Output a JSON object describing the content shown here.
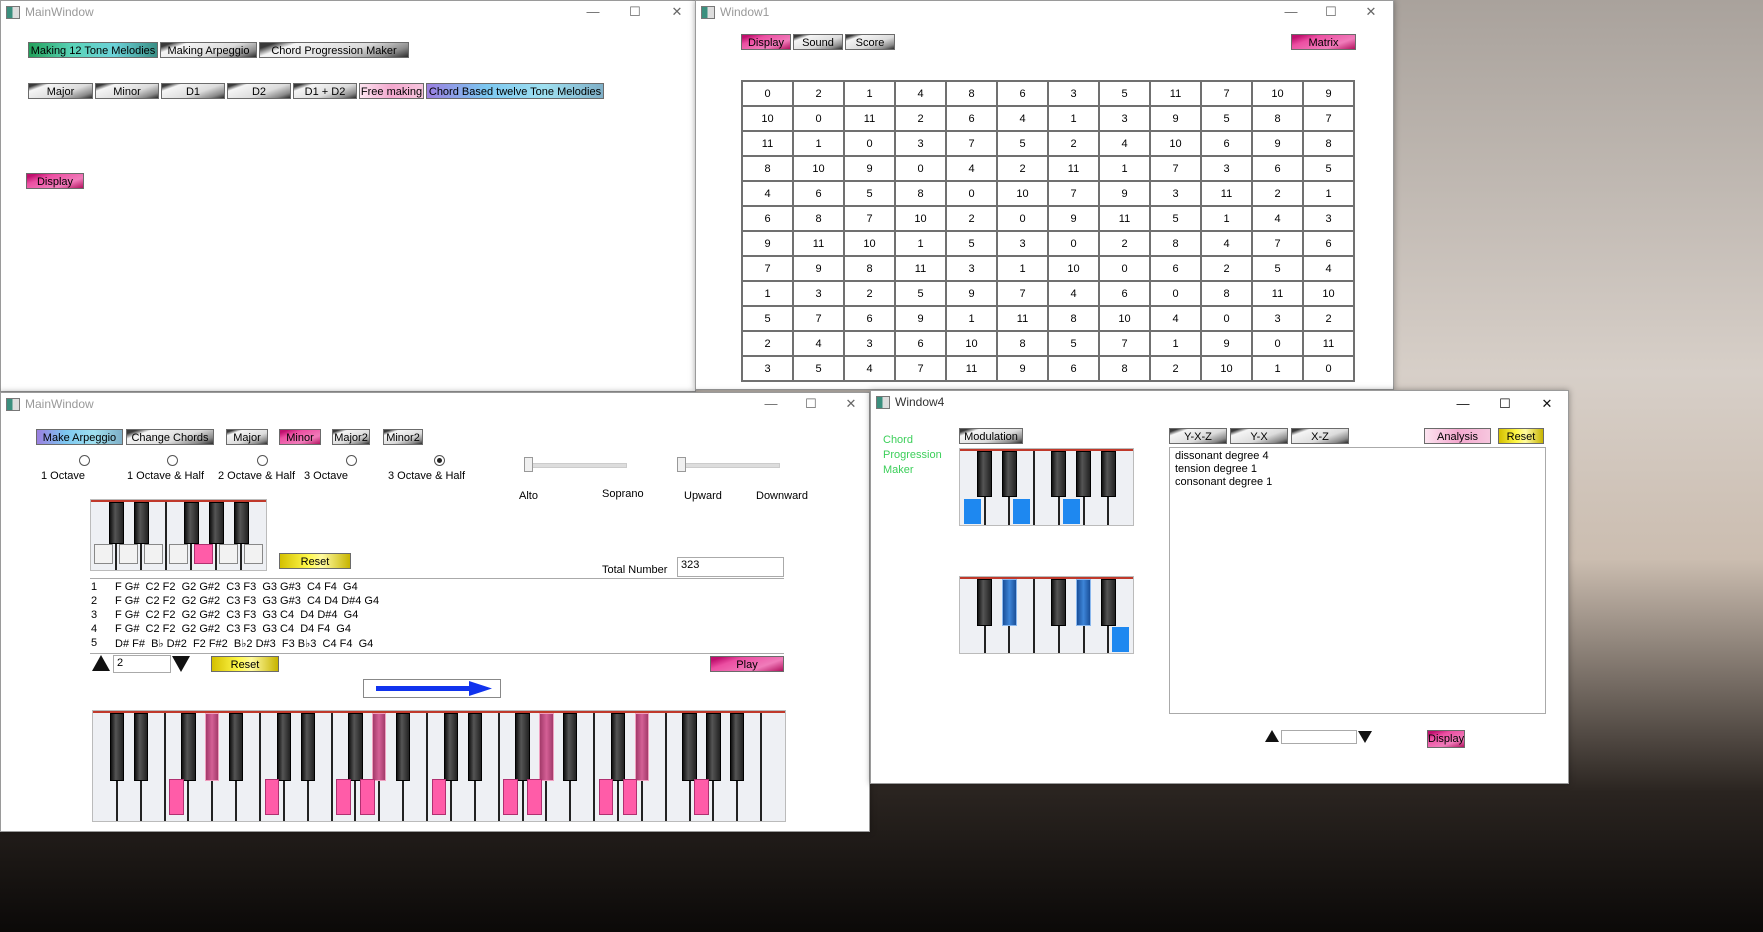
{
  "win_main1": {
    "title": "MainWindow",
    "mode_buttons": [
      "Making 12 Tone Melodies",
      "Making Arpeggio",
      "Chord Progression Maker"
    ],
    "type_buttons": [
      "Major",
      "Minor",
      "D1",
      "D2",
      "D1 + D2",
      "Free making",
      "Chord Based twelve Tone Melodies"
    ],
    "display_label": "Display"
  },
  "win1": {
    "title": "Window1",
    "tabs": [
      "Display",
      "Sound",
      "Score"
    ],
    "matrix_label": "Matrix",
    "matrix": [
      [
        0,
        2,
        1,
        4,
        8,
        6,
        3,
        5,
        11,
        7,
        10,
        9
      ],
      [
        10,
        0,
        11,
        2,
        6,
        4,
        1,
        3,
        9,
        5,
        8,
        7
      ],
      [
        11,
        1,
        0,
        3,
        7,
        5,
        2,
        4,
        10,
        6,
        9,
        8
      ],
      [
        8,
        10,
        9,
        0,
        4,
        2,
        11,
        1,
        7,
        3,
        6,
        5
      ],
      [
        4,
        6,
        5,
        8,
        0,
        10,
        7,
        9,
        3,
        11,
        2,
        1
      ],
      [
        6,
        8,
        7,
        10,
        2,
        0,
        9,
        11,
        5,
        1,
        4,
        3
      ],
      [
        9,
        11,
        10,
        1,
        5,
        3,
        0,
        2,
        8,
        4,
        7,
        6
      ],
      [
        7,
        9,
        8,
        11,
        3,
        1,
        10,
        0,
        6,
        2,
        5,
        4
      ],
      [
        1,
        3,
        2,
        5,
        9,
        7,
        4,
        6,
        0,
        8,
        11,
        10
      ],
      [
        5,
        7,
        6,
        9,
        1,
        11,
        8,
        10,
        4,
        0,
        3,
        2
      ],
      [
        2,
        4,
        3,
        6,
        10,
        8,
        5,
        7,
        1,
        9,
        0,
        11
      ],
      [
        3,
        5,
        4,
        7,
        11,
        9,
        6,
        8,
        2,
        10,
        1,
        0
      ]
    ]
  },
  "win_main2": {
    "title": "MainWindow",
    "buttons": [
      "Make Arpeggio",
      "Change Chords",
      "Major",
      "Minor",
      "Major2",
      "Minor2"
    ],
    "octave_options": [
      "1 Octave",
      "1 Octave & Half",
      "2 Octave & Half",
      "3 Octave",
      "3 Octave & Half"
    ],
    "octave_selected": 4,
    "slider1_labels": [
      "Alto",
      "Soprano"
    ],
    "slider2_labels": [
      "Upward",
      "Downward"
    ],
    "slider1_value": 0,
    "slider2_value": 0,
    "reset_label": "Reset",
    "total_number_label": "Total Number",
    "total_number_value": "323",
    "small_keyboard_selected_index": 4,
    "melodies": [
      {
        "n": "1",
        "notes": "F G#  C2 F2  G2 G#2  C3 F3  G3 G#3  C4 F4  G4"
      },
      {
        "n": "2",
        "notes": "F G#  C2 F2  G2 G#2  C3 F3  G3 G#3  C4 D4 D#4 G4"
      },
      {
        "n": "3",
        "notes": "F G#  C2 F2  G2 G#2  C3 F3  G3 C4  D4 D#4  G4"
      },
      {
        "n": "4",
        "notes": "F G#  C2 F2  G2 G#2  C3 F3  G3 C4  D4 F4  G4"
      },
      {
        "n": "5",
        "notes": "D# F#  B♭ D#2  F2 F#2  B♭2 D#3  F3 B♭3  C4 F4  G4"
      }
    ],
    "spinner_value": "2",
    "reset2_label": "Reset",
    "play_label": "Play",
    "big_keyboard": {
      "white_keys": 29,
      "pressed_white": [
        3,
        7,
        10,
        11,
        14,
        17,
        18,
        21,
        22,
        25
      ],
      "pressed_black": [
        3,
        8,
        13,
        16
      ]
    }
  },
  "win4": {
    "title": "Window4",
    "side_label": "Chord Progression Maker",
    "modulation_label": "Modulation",
    "transform_buttons": [
      "Y-X-Z",
      "Y-X",
      "X-Z"
    ],
    "analysis_label": "Analysis",
    "reset_label": "Reset",
    "analysis_lines": [
      "dissonant degree 4",
      "tension degree 1",
      "consonant degree 1"
    ],
    "spinner_value": "",
    "display_label": "Display",
    "kbd_top_pressed_white": [
      0,
      2,
      4
    ],
    "kbd_bottom_pressed_black": [
      1,
      3
    ],
    "kbd_bottom_pressed_white": [
      6
    ]
  }
}
